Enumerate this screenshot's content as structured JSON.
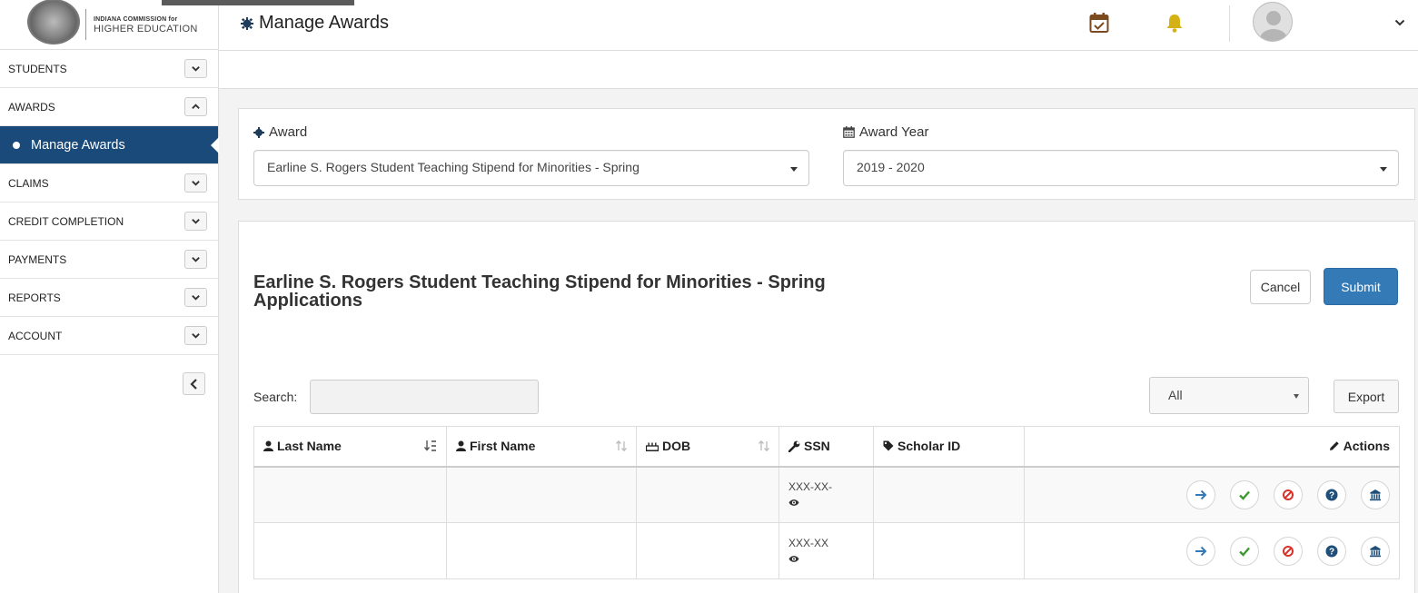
{
  "logo": {
    "line1": "INDIANA COMMISSION for",
    "line2": "HIGHER EDUCATION"
  },
  "sidebar": {
    "items": [
      {
        "label": "STUDENTS",
        "state": "collapsed"
      },
      {
        "label": "AWARDS",
        "state": "expanded"
      },
      {
        "label": "Manage Awards",
        "state": "active"
      },
      {
        "label": "CLAIMS",
        "state": "collapsed"
      },
      {
        "label": "CREDIT COMPLETION",
        "state": "collapsed"
      },
      {
        "label": "PAYMENTS",
        "state": "collapsed"
      },
      {
        "label": "REPORTS",
        "state": "collapsed"
      },
      {
        "label": "ACCOUNT",
        "state": "collapsed"
      }
    ]
  },
  "header": {
    "title": "Manage Awards"
  },
  "filters": {
    "award_label": "Award",
    "award_value": "Earline S. Rogers Student Teaching Stipend for Minorities - Spring",
    "year_label": "Award Year",
    "year_value": "2019 - 2020"
  },
  "main": {
    "title": "Earline S. Rogers Student Teaching Stipend for Minorities - Spring Applications",
    "cancel_label": "Cancel",
    "submit_label": "Submit",
    "search_label": "Search:",
    "search_value": "",
    "filter_value": "All",
    "export_label": "Export"
  },
  "table": {
    "columns": [
      "Last Name",
      "First Name",
      "DOB",
      "SSN",
      "Scholar ID",
      "Actions"
    ],
    "rows": [
      {
        "last_name": "",
        "first_name": "",
        "dob": "",
        "ssn": "XXX-XX-",
        "scholar_id": ""
      },
      {
        "last_name": "",
        "first_name": "",
        "dob": "",
        "ssn": "XXX-XX",
        "scholar_id": ""
      }
    ]
  },
  "colors": {
    "primary": "#337ab7",
    "sidebar_active": "#1a4a7a",
    "bell": "#d4b216",
    "calendar": "#7b4a1e"
  }
}
